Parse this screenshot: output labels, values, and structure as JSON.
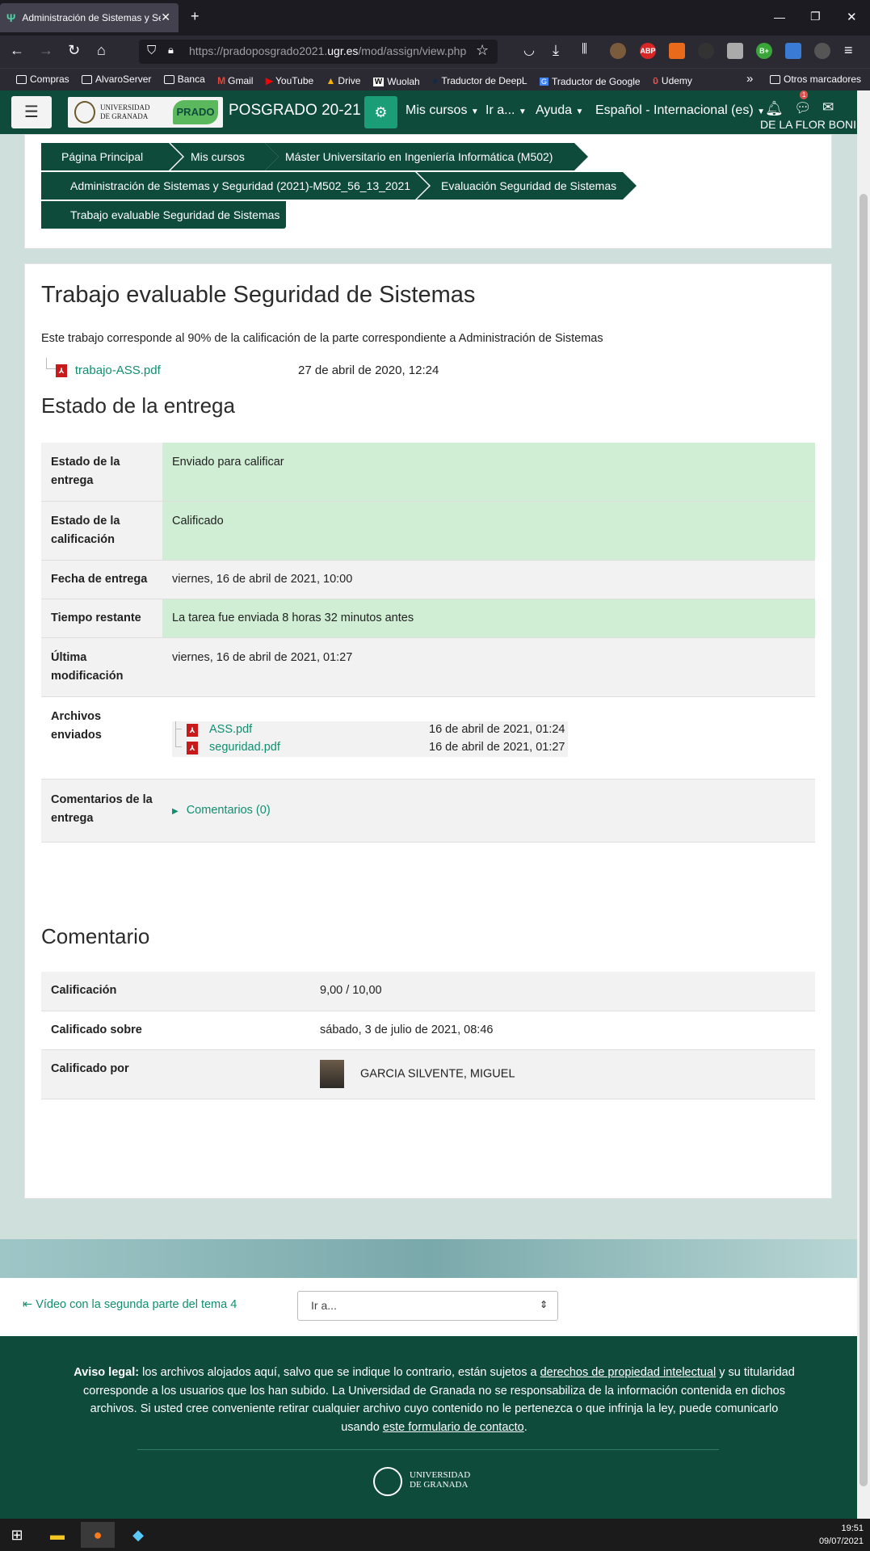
{
  "browser": {
    "tab_title": "Administración de Sistemas y Se",
    "tab_favicon": "Ψ",
    "url_prefix": "https://pradoposgrado2021.",
    "url_domain": "ugr.es",
    "url_path": "/mod/assign/view.php",
    "bookmarks": [
      "Compras",
      "AlvaroServer",
      "Banca",
      "Gmail",
      "YouTube",
      "Drive",
      "Wuolah",
      "Traductor de DeepL",
      "Traductor de Google",
      "Udemy"
    ],
    "other_bookmarks": "Otros marcadores",
    "ext_abp": "ABP",
    "ext_b": "B+"
  },
  "header": {
    "logo_line1": "UNIVERSIDAD",
    "logo_line2": "DE GRANADA",
    "logo_mark": "PRADO",
    "site_name": "POSGRADO 20-21",
    "menu": [
      "Mis cursos",
      "Ir a...",
      "Ayuda",
      "Español - Internacional (es)"
    ],
    "notification_badge": "1",
    "user_name": "DE LA FLOR BONIL"
  },
  "breadcrumb": [
    "Página Principal",
    "Mis cursos",
    "Máster Universitario en Ingeniería Informática (M502)",
    "Administración de Sistemas y Seguridad (2021)-M502_56_13_2021",
    "Evaluación Seguridad de Sistemas",
    "Trabajo evaluable Seguridad de Sistemas"
  ],
  "assignment": {
    "title": "Trabajo evaluable Seguridad de Sistemas",
    "description": "Este trabajo corresponde al 90% de la calificación de la parte correspondiente a Administración de Sistemas",
    "attachment_name": "trabajo-ASS.pdf",
    "attachment_date": "27 de abril de 2020, 12:24"
  },
  "submission": {
    "heading": "Estado de la entrega",
    "rows": [
      {
        "label": "Estado de la entrega",
        "value": "Enviado para calificar"
      },
      {
        "label": "Estado de la calificación",
        "value": "Calificado"
      },
      {
        "label": "Fecha de entrega",
        "value": "viernes, 16 de abril de 2021, 10:00"
      },
      {
        "label": "Tiempo restante",
        "value": "La tarea fue enviada 8 horas 32 minutos antes"
      },
      {
        "label": "Última modificación",
        "value": "viernes, 16 de abril de 2021, 01:27"
      },
      {
        "label": "Archivos enviados",
        "value": ""
      },
      {
        "label": "Comentarios de la entrega",
        "value": "Comentarios (0)"
      }
    ],
    "files": [
      {
        "name": "ASS.pdf",
        "date": "16 de abril de 2021, 01:24"
      },
      {
        "name": "seguridad.pdf",
        "date": "16 de abril de 2021, 01:27"
      }
    ]
  },
  "feedback": {
    "heading": "Comentario",
    "rows": [
      {
        "label": "Calificación",
        "value": "9,00 / 10,00"
      },
      {
        "label": "Calificado sobre",
        "value": "sábado, 3 de julio de 2021, 08:46"
      },
      {
        "label": "Calificado por",
        "value": "GARCIA SILVENTE, MIGUEL"
      }
    ]
  },
  "navigation": {
    "prev_link": "Vídeo con la segunda parte del tema 4",
    "jump_placeholder": "Ir a..."
  },
  "footer": {
    "legal_bold": "Aviso legal:",
    "legal_text1": " los archivos alojados aquí, salvo que se indique lo contrario, están sujetos a ",
    "legal_link1": "derechos de propiedad intelectual",
    "legal_text2": " y su titularidad corresponde a los usuarios que los han subido. La Universidad de Granada no se responsabiliza de la información contenida en dichos archivos. Si usted cree conveniente retirar cualquier archivo cuyo contenido no le pertenezca o que infrinja la ley, puede comunicarlo usando ",
    "legal_link2": "este formulario de contacto",
    "legal_text3": ".",
    "logo_line1": "UNIVERSIDAD",
    "logo_line2": "DE GRANADA"
  },
  "taskbar": {
    "time": "19:51",
    "date": "09/07/2021"
  },
  "colors": {
    "brand_dark_green": "#0e4b3a",
    "accent_green": "#1b9e77",
    "success_row": "#cfeed4",
    "link": "#0f8f6f"
  }
}
